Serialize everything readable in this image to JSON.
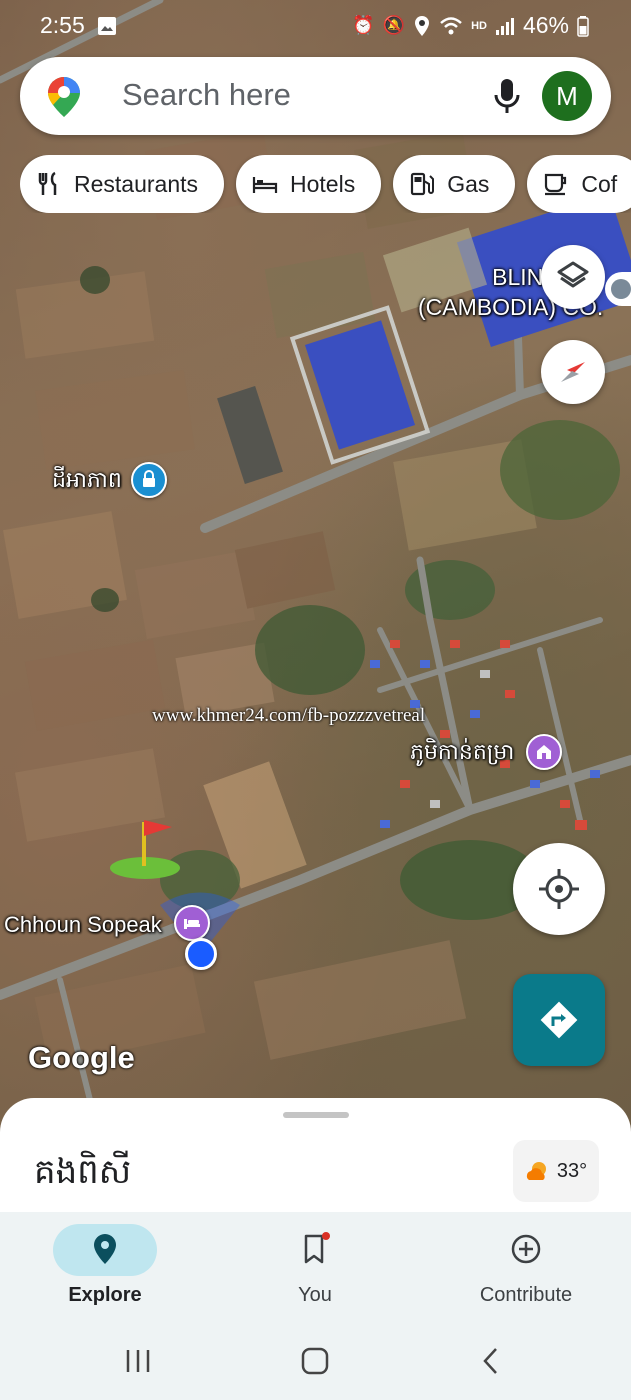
{
  "status_bar": {
    "time": "2:55",
    "battery": "46%",
    "network": "HD"
  },
  "search": {
    "placeholder": "Search here",
    "avatar_letter": "M",
    "avatar_color": "#1e6f1e"
  },
  "chips": [
    {
      "label": "Restaurants",
      "icon": "fork-knife-icon"
    },
    {
      "label": "Hotels",
      "icon": "bed-icon"
    },
    {
      "label": "Gas",
      "icon": "gas-pump-icon"
    },
    {
      "label": "Cof",
      "icon": "coffee-icon"
    }
  ],
  "map": {
    "labels": {
      "factory": "BLIN\n(CAMBODIA) CO.",
      "place_1": "ដីអាភាព",
      "village": "ភូមិកាន់តម្រា",
      "hotel": "Chhoun Sopeak"
    },
    "watermark": "www.khmer24.com/fb-pozzzvetreal",
    "attribution": "Google"
  },
  "sheet": {
    "title": "គងពិសី",
    "temperature": "33°"
  },
  "nav": {
    "items": [
      {
        "label": "Explore",
        "icon": "explore-pin-icon",
        "active": true
      },
      {
        "label": "You",
        "icon": "bookmark-icon",
        "active": false
      },
      {
        "label": "Contribute",
        "icon": "add-circle-icon",
        "active": false
      }
    ]
  },
  "colors": {
    "accent": "#0a7a8a",
    "nav_active": "#bfe6ef",
    "user_dot": "#1a5cff"
  }
}
